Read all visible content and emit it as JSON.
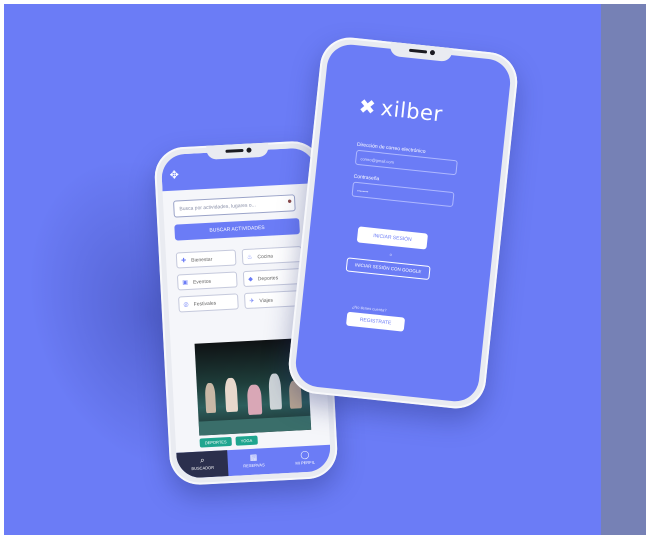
{
  "colors": {
    "brand": "#6b7cf6",
    "accent_green": "#1fa58f",
    "nav_active": "#2b2f4d"
  },
  "left_phone": {
    "header_icon": "gear-icon",
    "search": {
      "placeholder": "Busca por actividades, lugares o...",
      "icon": "search-icon"
    },
    "primary_button": "BUSCAR ACTIVIDADES",
    "categories": [
      {
        "label": "Bienestar",
        "icon": "bienestar-icon"
      },
      {
        "label": "Cocina",
        "icon": "cocina-icon"
      },
      {
        "label": "Eventos",
        "icon": "eventos-icon"
      },
      {
        "label": "Deportes",
        "icon": "deportes-icon"
      },
      {
        "label": "Festivales",
        "icon": "festivales-icon"
      },
      {
        "label": "Viajes",
        "icon": "viajes-icon"
      }
    ],
    "tags": [
      "DEPORTES",
      "YOGA"
    ],
    "nav": [
      {
        "label": "BUSCADOR",
        "icon": "search-icon"
      },
      {
        "label": "RESERVAS",
        "icon": "calendar-icon"
      },
      {
        "label": "MI PERFIL",
        "icon": "user-icon"
      }
    ]
  },
  "right_phone": {
    "brand": "xilber",
    "email_label": "Dirección de correo electrónico",
    "email_value": "correo@gmail.com",
    "password_label": "Contraseña",
    "password_value": "••••••••",
    "login_button": "INICIAR SESIÓN",
    "or_text": "o",
    "social_button": "INICIAR SESIÓN CON GOOGLE",
    "register_prompt": "¿No tienes cuenta?",
    "register_button": "REGISTRATE"
  }
}
